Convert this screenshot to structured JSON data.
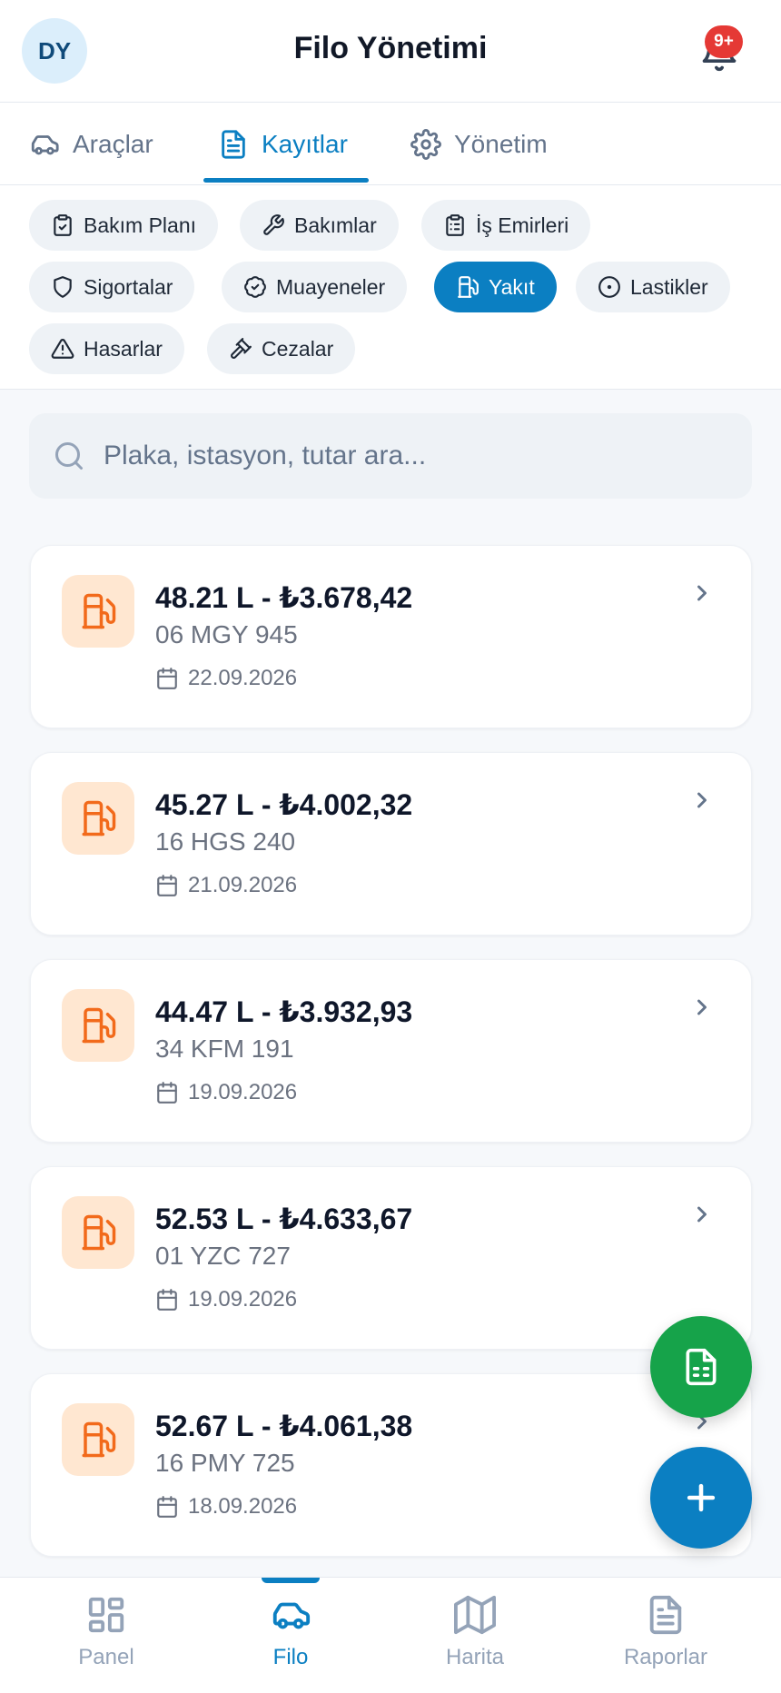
{
  "header": {
    "avatar_initials": "DY",
    "title": "Filo Yönetimi",
    "notification_badge": "9+"
  },
  "tabs": [
    {
      "label": "Araçlar",
      "icon": "car-icon",
      "active": false
    },
    {
      "label": "Kayıtlar",
      "icon": "document-icon",
      "active": true
    },
    {
      "label": "Yönetim",
      "icon": "gear-icon",
      "active": false
    }
  ],
  "chips": [
    {
      "label": "Bakım Planı",
      "icon": "clipboard-check-icon"
    },
    {
      "label": "Bakımlar",
      "icon": "wrench-icon"
    },
    {
      "label": "İş Emirleri",
      "icon": "clipboard-list-icon"
    },
    {
      "label": "Sigortalar",
      "icon": "shield-icon"
    },
    {
      "label": "Muayeneler",
      "icon": "badge-check-icon"
    },
    {
      "label": "Yakıt",
      "icon": "fuel-icon",
      "active": true
    },
    {
      "label": "Lastikler",
      "icon": "tire-icon"
    },
    {
      "label": "Hasarlar",
      "icon": "warning-icon"
    },
    {
      "label": "Cezalar",
      "icon": "gavel-icon"
    }
  ],
  "search": {
    "placeholder": "Plaka, istasyon, tutar ara..."
  },
  "records": [
    {
      "amount": "48.21 L - ₺3.678,42",
      "plate": "06 MGY 945",
      "date": "22.09.2026"
    },
    {
      "amount": "45.27 L - ₺4.002,32",
      "plate": "16 HGS 240",
      "date": "21.09.2026"
    },
    {
      "amount": "44.47 L - ₺3.932,93",
      "plate": "34 KFM 191",
      "date": "19.09.2026"
    },
    {
      "amount": "52.53 L - ₺4.633,67",
      "plate": "01 YZC 727",
      "date": "19.09.2026"
    },
    {
      "amount": "52.67 L - ₺4.061,38",
      "plate": "16 PMY 725",
      "date": "18.09.2026"
    }
  ],
  "bottom_nav": [
    {
      "label": "Panel",
      "icon": "grid-icon"
    },
    {
      "label": "Filo",
      "icon": "car-icon",
      "active": true
    },
    {
      "label": "Harita",
      "icon": "map-icon"
    },
    {
      "label": "Raporlar",
      "icon": "report-icon"
    }
  ],
  "colors": {
    "accent": "#0b7fc2",
    "fab_report": "#16a34a",
    "fuel_icon": "#f26a1b",
    "badge": "#e53935"
  }
}
